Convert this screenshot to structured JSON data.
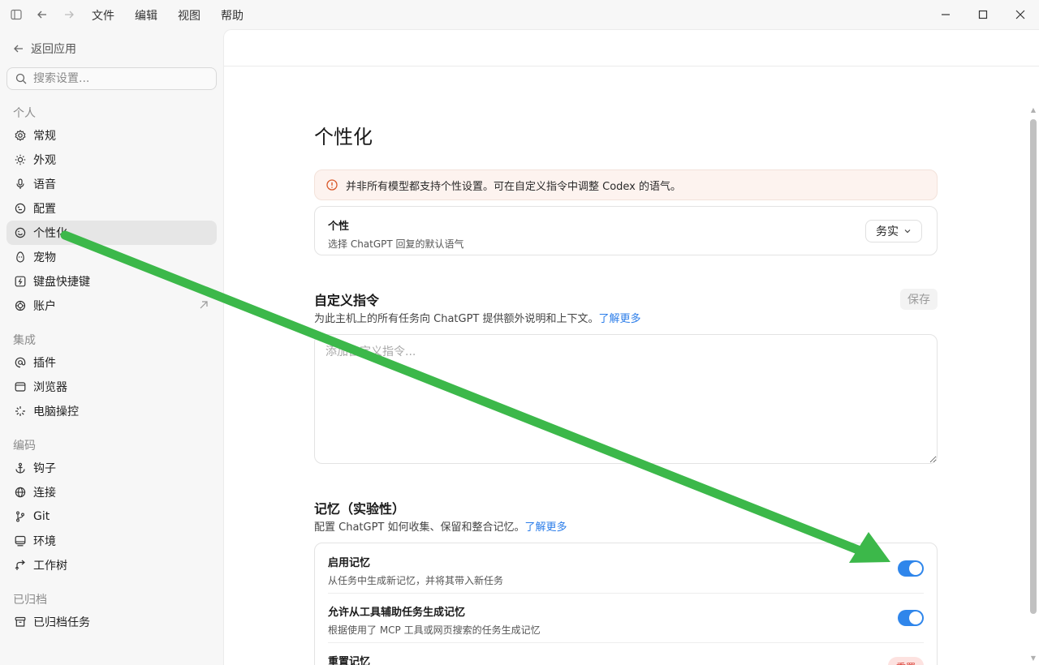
{
  "titlebar": {
    "menus": [
      "文件",
      "编辑",
      "视图",
      "帮助"
    ]
  },
  "sidebar": {
    "back_label": "返回应用",
    "search_placeholder": "搜索设置...",
    "sections": [
      {
        "label": "个人",
        "items": [
          {
            "label": "常规",
            "icon": "gear-icon"
          },
          {
            "label": "外观",
            "icon": "sun-icon"
          },
          {
            "label": "语音",
            "icon": "microphone-icon"
          },
          {
            "label": "配置",
            "icon": "sliders-icon"
          },
          {
            "label": "个性化",
            "icon": "smiley-icon",
            "active": true
          },
          {
            "label": "宠物",
            "icon": "egg-icon"
          },
          {
            "label": "键盘快捷键",
            "icon": "keyboard-icon"
          },
          {
            "label": "账户",
            "icon": "openai-icon",
            "external": true
          }
        ]
      },
      {
        "label": "集成",
        "items": [
          {
            "label": "插件",
            "icon": "at-icon"
          },
          {
            "label": "浏览器",
            "icon": "browser-icon"
          },
          {
            "label": "电脑操控",
            "icon": "sparkle-icon"
          }
        ]
      },
      {
        "label": "编码",
        "items": [
          {
            "label": "钩子",
            "icon": "anchor-icon"
          },
          {
            "label": "连接",
            "icon": "globe-icon"
          },
          {
            "label": "Git",
            "icon": "git-branch-icon"
          },
          {
            "label": "环境",
            "icon": "monitor-icon"
          },
          {
            "label": "工作树",
            "icon": "worktree-icon"
          }
        ]
      },
      {
        "label": "已归档",
        "items": [
          {
            "label": "已归档任务",
            "icon": "archive-icon"
          }
        ]
      }
    ]
  },
  "main": {
    "title": "个性化",
    "alert": "并非所有模型都支持个性设置。可在自定义指令中调整 Codex 的语气。",
    "personality": {
      "title": "个性",
      "subtitle": "选择 ChatGPT 回复的默认语气",
      "selected": "务实"
    },
    "custom_instructions": {
      "title": "自定义指令",
      "desc": "为此主机上的所有任务向 ChatGPT 提供额外说明和上下文。",
      "learn_more": "了解更多",
      "save_label": "保存",
      "placeholder": "添加自定义指令..."
    },
    "memory": {
      "title": "记忆（实验性）",
      "desc": "配置 ChatGPT 如何收集、保留和整合记忆。",
      "learn_more": "了解更多",
      "rows": [
        {
          "title": "启用记忆",
          "subtitle": "从任务中生成新记忆，并将其带入新任务",
          "enabled": true
        },
        {
          "title": "允许从工具辅助任务生成记忆",
          "subtitle": "根据使用了 MCP 工具或网页搜索的任务生成记忆",
          "enabled": true
        },
        {
          "title": "重置记忆",
          "button": "重置"
        }
      ]
    }
  },
  "colors": {
    "accent": "#2f86eb",
    "annotation_arrow": "#3cb84a",
    "alert_bg": "#fdf3ef",
    "danger": "#d93a2f"
  }
}
